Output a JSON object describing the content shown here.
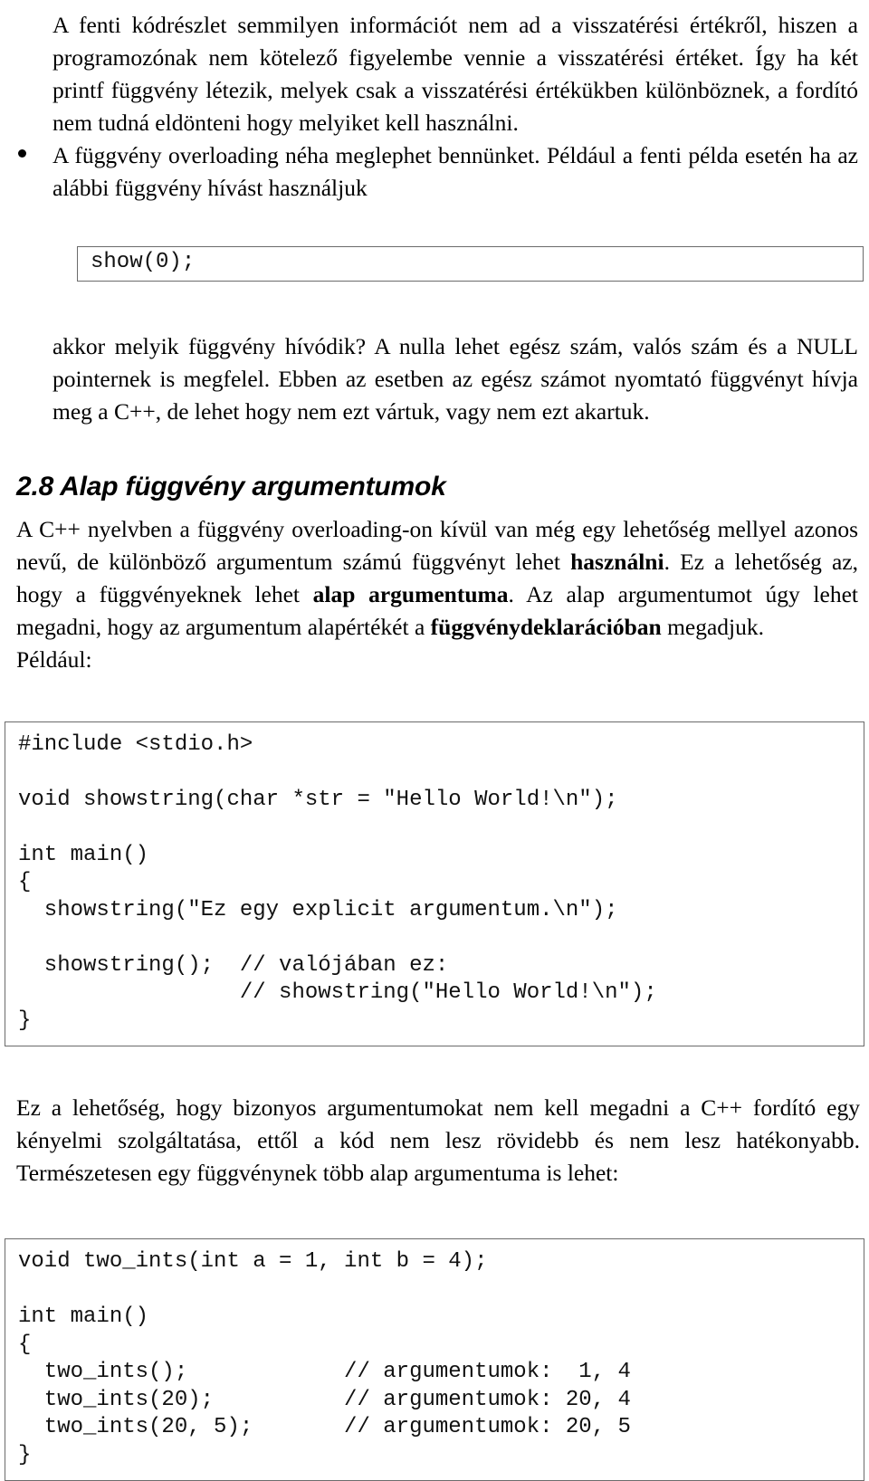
{
  "document": {
    "language": "hu",
    "paragraph_1": {
      "part_a": "A fenti kódrészlet semmilyen információt nem ad a visszatérési értékről, hiszen a programozónak nem kötelező figyelembe vennie a visszatérési értéket. Így ha két printf függvény létezik, melyek csak a visszatérési értékükben különböznek, a fordító nem tudná eldönteni hogy melyiket kell használni."
    },
    "bullet_1": {
      "marker": "bullet-dot",
      "text": "A függvény overloading néha meglephet bennünket. Például a fenti példa esetén ha az alábbi függvény hívást használjuk"
    },
    "code_block_1": "show(0);",
    "paragraph_2": "akkor melyik függvény hívódik? A nulla lehet egész szám, valós szám és a NULL pointernek is megfelel. Ebben az esetben az egész számot nyomtató függvényt hívja meg a C++, de lehet hogy nem ezt vártuk, vagy nem ezt akartuk.",
    "heading_2_8": "2.8 Alap függvény argumentumok",
    "paragraph_3": {
      "seg_1": "A C++ nyelvben a függvény overloading-on kívül van még egy lehetőség mellyel azonos nevű, de különböző argumentum számú függvényt lehet ",
      "bold_1": "használni",
      "seg_2": ". Ez a lehetőség az, hogy a függvényeknek lehet ",
      "bold_2": "alap argumentuma",
      "seg_3": ". Az alap argumentumot úgy lehet megadni, hogy az argumentum alapértékét a ",
      "bold_3": "függvénydeklarációban",
      "seg_4": " megadjuk."
    },
    "paragraph_3_tail": "Például:",
    "code_block_2": "#include <stdio.h>\n\nvoid showstring(char *str = \"Hello World!\\n\");\n\nint main()\n{\n  showstring(\"Ez egy explicit argumentum.\\n\");\n\n  showstring();  // valójában ez:\n                 // showstring(\"Hello World!\\n\");\n}",
    "paragraph_4": "Ez a lehetőség, hogy bizonyos argumentumokat nem kell megadni a C++ fordító egy kényelmi szolgáltatása, ettől a kód nem lesz rövidebb és nem lesz hatékonyabb. Természetesen egy függvénynek több alap argumentuma is lehet:",
    "code_block_3": "void two_ints(int a = 1, int b = 4);\n\nint main()\n{\n  two_ints();            // argumentumok:  1, 4\n  two_ints(20);          // argumentumok: 20, 4\n  two_ints(20, 5);       // argumentumok: 20, 5\n}"
  },
  "colors": {
    "text": "#000000",
    "background": "#ffffff",
    "code_border": "#6b6b6b",
    "code_text": "#111111"
  }
}
